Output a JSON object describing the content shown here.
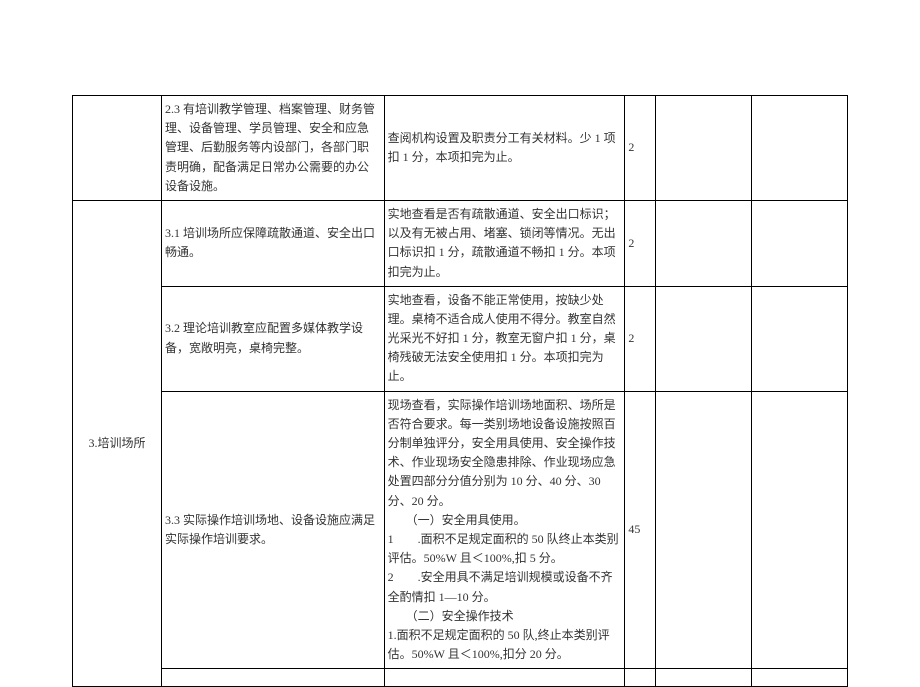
{
  "rows": [
    {
      "category": "",
      "item": "2.3 有培训教学管理、档案管理、财务管理、设备管理、学员管理、安全和应急管理、后勤服务等内设部门，各部门职责明确，配备满足日常办公需要的办公设备设施。",
      "criteria": "查阅机构设置及职责分工有关材料。少 1 项扣 1 分，本项扣完为止。",
      "score": "2"
    },
    {
      "category": "3.培训场所",
      "categoryRowspan": 4,
      "item": "3.1 培训场所应保障疏散通道、安全出口畅通。",
      "criteria": "实地查看是否有疏散通道、安全出口标识；以及有无被占用、堵塞、锁闭等情况。无出口标识扣 1 分，疏散通道不畅扣 1 分。本项扣完为止。",
      "score": "2"
    },
    {
      "item": "3.2 理论培训教室应配置多媒体教学设备，宽敞明亮，桌椅完整。",
      "criteria": "实地查看，设备不能正常使用，按缺少处理。桌椅不适合成人使用不得分。教室自然光采光不好扣 1 分，教室无窗户扣 1 分，桌椅残破无法安全使用扣 1 分。本项扣完为止。",
      "score": "2"
    },
    {
      "item": "3.3 实际操作培训场地、设备设施应满足实际操作培训要求。",
      "criteria_parts": {
        "p1": "现场查看，实际操作培训场地面积、场所是否符合要求。每一类别场地设备设施按照百分制单独评分，安全用具使用、安全操作技术、作业现场安全隐患排除、作业现场应急处置四部分分值分别为 10 分、40 分、30 分、20 分。",
        "p2": "（一）安全用具使用。",
        "p3": "1　　.面积不足规定面积的 50 队终止本类别评估。50%W 且＜100%,扣 5 分。",
        "p4": "2　　.安全用具不满足培训规模或设备不齐全酌情扣 1—10 分。",
        "p5": "（二）安全操作技术",
        "p6": "1.面积不足规定面积的 50 队,终止本类别评估。50%W 且＜100%,扣分 20 分。"
      },
      "score": "45"
    },
    {
      "item": "",
      "criteria": "",
      "score": ""
    }
  ]
}
